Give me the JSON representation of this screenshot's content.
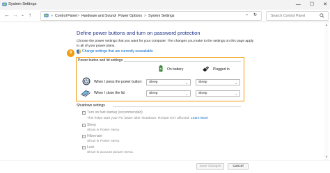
{
  "window": {
    "title": "System Settings",
    "minimize_glyph": "—",
    "maximize_glyph": "☐",
    "close_glyph": "✕"
  },
  "address": {
    "breadcrumbs": [
      "Control Panel",
      "Hardware and Sound",
      "Power Options",
      "System Settings"
    ],
    "separator": ">",
    "dropdown_glyph": "⌄",
    "refresh_glyph": "↻",
    "search_placeholder": "Search Control Panel"
  },
  "nav": {
    "back": "←",
    "forward": "→",
    "recent": "⌄",
    "up": "↑"
  },
  "main": {
    "heading": "Define power buttons and turn on password protection",
    "intro": "Choose the power settings that you want for your computer. The changes you make to the settings on this page apply to all of your power plans.",
    "change_link": "Change settings that are currently unavailable",
    "step_badge": "9"
  },
  "power_group": {
    "label": "Power button and lid settings",
    "columns": [
      "On battery",
      "Plugged in"
    ],
    "rows": [
      {
        "label": "When I press the power button:",
        "on_battery": "Sleep",
        "plugged_in": "Sleep"
      },
      {
        "label": "When I close the lid:",
        "on_battery": "Sleep",
        "plugged_in": "Sleep"
      }
    ],
    "chevron": "⌄"
  },
  "shutdown": {
    "label": "Shutdown settings",
    "items": [
      {
        "label": "Turn on fast startup (recommended)",
        "desc": "This helps start your PC faster after shutdown. Restart isn't affected.",
        "link": "Learn More",
        "checked": false
      },
      {
        "label": "Sleep",
        "desc": "Show in Power menu.",
        "checked": false
      },
      {
        "label": "Hibernate",
        "desc": "Show in Power menu.",
        "checked": false
      },
      {
        "label": "Lock",
        "desc": "Show in account picture menu.",
        "checked": false
      }
    ]
  },
  "footer": {
    "save": "Save changes",
    "cancel": "Cancel"
  },
  "colors": {
    "accent": "#f29c11",
    "heading": "#1e3287",
    "link": "#0066cc"
  }
}
